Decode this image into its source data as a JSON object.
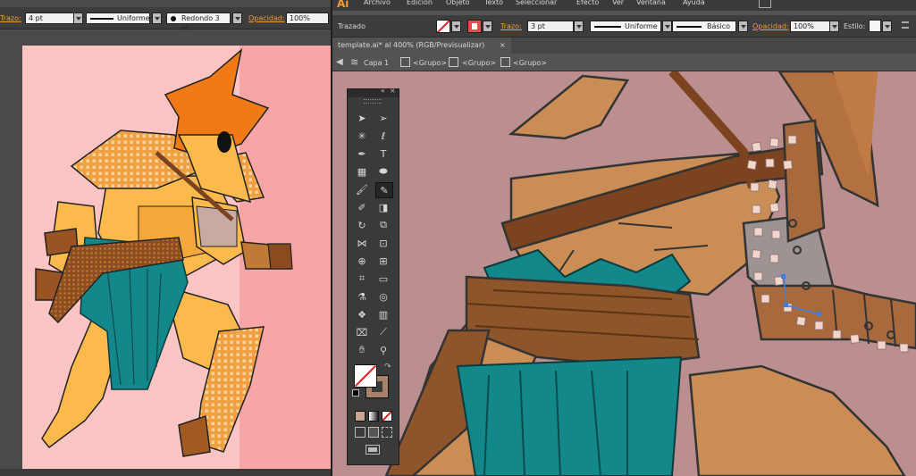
{
  "left_window": {
    "control_bar": {
      "stroke_label": "Trazo:",
      "stroke_weight": "4 pt",
      "profile": "Uniforme",
      "brush": "Redondo 3 pt.",
      "opacity_label": "Opacidad:",
      "opacity_value": "100%"
    }
  },
  "right_window": {
    "app_logo": "Ai",
    "menu": [
      "Archivo",
      "Edición",
      "Objeto",
      "Texto",
      "Seleccionar",
      "Efecto",
      "Ver",
      "Ventana",
      "Ayuda"
    ],
    "control_bar": {
      "selection_label": "Trazado",
      "stroke_label": "Trazo:",
      "stroke_weight": "3 pt",
      "profile": "Uniforme",
      "brush": "Básico",
      "opacity_label": "Opacidad:",
      "opacity_value": "100%",
      "style_label": "Estilo:"
    },
    "document_tab": {
      "title": "template.ai* al 400% (RGB/Previsualizar)",
      "close": "×"
    },
    "breadcrumb": [
      "Capa 1",
      "<Grupo>",
      "<Grupo>",
      "<Grupo>"
    ]
  },
  "tools_panel": {
    "tools": [
      [
        "selection-tool",
        "direct-selection-tool"
      ],
      [
        "magic-wand-tool",
        "lasso-tool"
      ],
      [
        "pen-tool",
        "type-tool"
      ],
      [
        "line-segment-tool",
        "ellipse-tool"
      ],
      [
        "paintbrush-tool",
        "pencil-tool"
      ],
      [
        "blob-brush-tool",
        "eraser-tool"
      ],
      [
        "rotate-tool",
        "scale-tool"
      ],
      [
        "width-tool",
        "free-transform-tool"
      ],
      [
        "shape-builder-tool",
        "perspective-grid-tool"
      ],
      [
        "mesh-tool",
        "gradient-tool"
      ],
      [
        "eyedropper-tool",
        "blend-tool"
      ],
      [
        "symbol-sprayer-tool",
        "column-graph-tool"
      ],
      [
        "artboard-tool",
        "slice-tool"
      ],
      [
        "hand-tool",
        "zoom-tool"
      ]
    ],
    "active_tool": "pencil-tool"
  },
  "colors": {
    "ui_dark": "#535353",
    "accent_orange": "#f39c33",
    "left_canvas_pink": "#fdc4c4",
    "right_canvas_mauve": "#bb8f8f",
    "skin_tan": "#c98d55",
    "teal_cloth": "#13888b",
    "brown_belt": "#7b4320"
  }
}
